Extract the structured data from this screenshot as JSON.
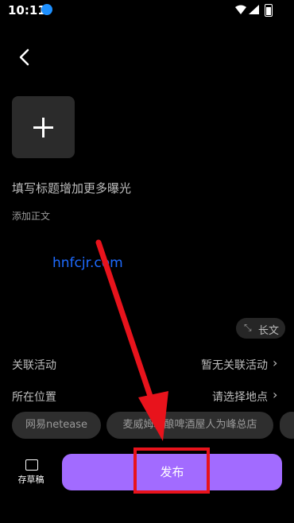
{
  "status_bar": {
    "time": "10:11"
  },
  "editor": {
    "title_placeholder": "填写标题增加更多曝光",
    "body_placeholder": "添加正文",
    "watermark": "hnfcjr.com",
    "long_text_label": "长文",
    "long_text_icon": "expand-icon"
  },
  "settings": {
    "activity_label": "关联活动",
    "activity_value": "暂无关联活动",
    "location_label": "所在位置",
    "location_value": "请选择地点"
  },
  "location_chips": [
    "网易netease",
    "麦威姆精酿啤酒屋人为峰总店"
  ],
  "footer": {
    "drafts_label": "存草稿",
    "publish_label": "发布"
  },
  "colors": {
    "accent": "#a26bff",
    "highlight": "#e8131c",
    "watermark": "#1e6bff"
  }
}
